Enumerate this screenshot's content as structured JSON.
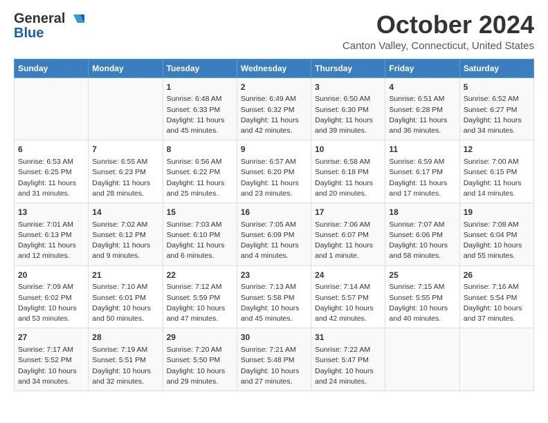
{
  "header": {
    "logo_line1": "General",
    "logo_line2": "Blue",
    "month_title": "October 2024",
    "location": "Canton Valley, Connecticut, United States"
  },
  "weekdays": [
    "Sunday",
    "Monday",
    "Tuesday",
    "Wednesday",
    "Thursday",
    "Friday",
    "Saturday"
  ],
  "weeks": [
    [
      {
        "day": "",
        "info": ""
      },
      {
        "day": "",
        "info": ""
      },
      {
        "day": "1",
        "info": "Sunrise: 6:48 AM\nSunset: 6:33 PM\nDaylight: 11 hours and 45 minutes."
      },
      {
        "day": "2",
        "info": "Sunrise: 6:49 AM\nSunset: 6:32 PM\nDaylight: 11 hours and 42 minutes."
      },
      {
        "day": "3",
        "info": "Sunrise: 6:50 AM\nSunset: 6:30 PM\nDaylight: 11 hours and 39 minutes."
      },
      {
        "day": "4",
        "info": "Sunrise: 6:51 AM\nSunset: 6:28 PM\nDaylight: 11 hours and 36 minutes."
      },
      {
        "day": "5",
        "info": "Sunrise: 6:52 AM\nSunset: 6:27 PM\nDaylight: 11 hours and 34 minutes."
      }
    ],
    [
      {
        "day": "6",
        "info": "Sunrise: 6:53 AM\nSunset: 6:25 PM\nDaylight: 11 hours and 31 minutes."
      },
      {
        "day": "7",
        "info": "Sunrise: 6:55 AM\nSunset: 6:23 PM\nDaylight: 11 hours and 28 minutes."
      },
      {
        "day": "8",
        "info": "Sunrise: 6:56 AM\nSunset: 6:22 PM\nDaylight: 11 hours and 25 minutes."
      },
      {
        "day": "9",
        "info": "Sunrise: 6:57 AM\nSunset: 6:20 PM\nDaylight: 11 hours and 23 minutes."
      },
      {
        "day": "10",
        "info": "Sunrise: 6:58 AM\nSunset: 6:18 PM\nDaylight: 11 hours and 20 minutes."
      },
      {
        "day": "11",
        "info": "Sunrise: 6:59 AM\nSunset: 6:17 PM\nDaylight: 11 hours and 17 minutes."
      },
      {
        "day": "12",
        "info": "Sunrise: 7:00 AM\nSunset: 6:15 PM\nDaylight: 11 hours and 14 minutes."
      }
    ],
    [
      {
        "day": "13",
        "info": "Sunrise: 7:01 AM\nSunset: 6:13 PM\nDaylight: 11 hours and 12 minutes."
      },
      {
        "day": "14",
        "info": "Sunrise: 7:02 AM\nSunset: 6:12 PM\nDaylight: 11 hours and 9 minutes."
      },
      {
        "day": "15",
        "info": "Sunrise: 7:03 AM\nSunset: 6:10 PM\nDaylight: 11 hours and 6 minutes."
      },
      {
        "day": "16",
        "info": "Sunrise: 7:05 AM\nSunset: 6:09 PM\nDaylight: 11 hours and 4 minutes."
      },
      {
        "day": "17",
        "info": "Sunrise: 7:06 AM\nSunset: 6:07 PM\nDaylight: 11 hours and 1 minute."
      },
      {
        "day": "18",
        "info": "Sunrise: 7:07 AM\nSunset: 6:06 PM\nDaylight: 10 hours and 58 minutes."
      },
      {
        "day": "19",
        "info": "Sunrise: 7:08 AM\nSunset: 6:04 PM\nDaylight: 10 hours and 55 minutes."
      }
    ],
    [
      {
        "day": "20",
        "info": "Sunrise: 7:09 AM\nSunset: 6:02 PM\nDaylight: 10 hours and 53 minutes."
      },
      {
        "day": "21",
        "info": "Sunrise: 7:10 AM\nSunset: 6:01 PM\nDaylight: 10 hours and 50 minutes."
      },
      {
        "day": "22",
        "info": "Sunrise: 7:12 AM\nSunset: 5:59 PM\nDaylight: 10 hours and 47 minutes."
      },
      {
        "day": "23",
        "info": "Sunrise: 7:13 AM\nSunset: 5:58 PM\nDaylight: 10 hours and 45 minutes."
      },
      {
        "day": "24",
        "info": "Sunrise: 7:14 AM\nSunset: 5:57 PM\nDaylight: 10 hours and 42 minutes."
      },
      {
        "day": "25",
        "info": "Sunrise: 7:15 AM\nSunset: 5:55 PM\nDaylight: 10 hours and 40 minutes."
      },
      {
        "day": "26",
        "info": "Sunrise: 7:16 AM\nSunset: 5:54 PM\nDaylight: 10 hours and 37 minutes."
      }
    ],
    [
      {
        "day": "27",
        "info": "Sunrise: 7:17 AM\nSunset: 5:52 PM\nDaylight: 10 hours and 34 minutes."
      },
      {
        "day": "28",
        "info": "Sunrise: 7:19 AM\nSunset: 5:51 PM\nDaylight: 10 hours and 32 minutes."
      },
      {
        "day": "29",
        "info": "Sunrise: 7:20 AM\nSunset: 5:50 PM\nDaylight: 10 hours and 29 minutes."
      },
      {
        "day": "30",
        "info": "Sunrise: 7:21 AM\nSunset: 5:48 PM\nDaylight: 10 hours and 27 minutes."
      },
      {
        "day": "31",
        "info": "Sunrise: 7:22 AM\nSunset: 5:47 PM\nDaylight: 10 hours and 24 minutes."
      },
      {
        "day": "",
        "info": ""
      },
      {
        "day": "",
        "info": ""
      }
    ]
  ]
}
